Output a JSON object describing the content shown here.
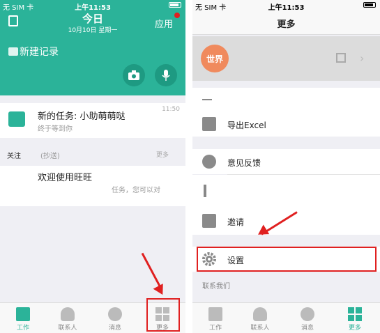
{
  "left": {
    "status": {
      "carrier": "无 SIM 卡",
      "time": "上午11:53"
    },
    "header": {
      "title": "今日",
      "date": "10月10日 星期一",
      "apps_label": "应用"
    },
    "new_record": "新建记录",
    "task": {
      "title": "新的任务: 小助萌萌哒",
      "subtitle": "终于等到你",
      "time": "11:50"
    },
    "follow": {
      "label": "关注",
      "cc": "(抄送)",
      "more": "更多"
    },
    "welcome": {
      "title": "欢迎使用旺旺",
      "subtitle": "任务，您可以对"
    },
    "tabs": [
      {
        "label": "工作"
      },
      {
        "label": "联系人"
      },
      {
        "label": "消息"
      },
      {
        "label": "更多"
      }
    ],
    "accent": "#2bb399"
  },
  "right": {
    "status": {
      "carrier": "无 SIM 卡",
      "time": "上午11:53"
    },
    "title": "更多",
    "profile": {
      "avatar_text": "世界"
    },
    "menu": [
      {
        "label": "导出Excel",
        "icon": "excel-icon"
      },
      {
        "label": "意见反馈",
        "icon": "feedback-icon"
      },
      {
        "label": "邀请",
        "icon": "invite-icon"
      },
      {
        "label": "设置",
        "icon": "gear-icon"
      }
    ],
    "contact_us": "联系我们",
    "tabs": [
      {
        "label": "工作"
      },
      {
        "label": "联系人"
      },
      {
        "label": "消息"
      },
      {
        "label": "更多"
      }
    ],
    "accent_orange": "#f08a5d",
    "highlight": "#e02020"
  }
}
